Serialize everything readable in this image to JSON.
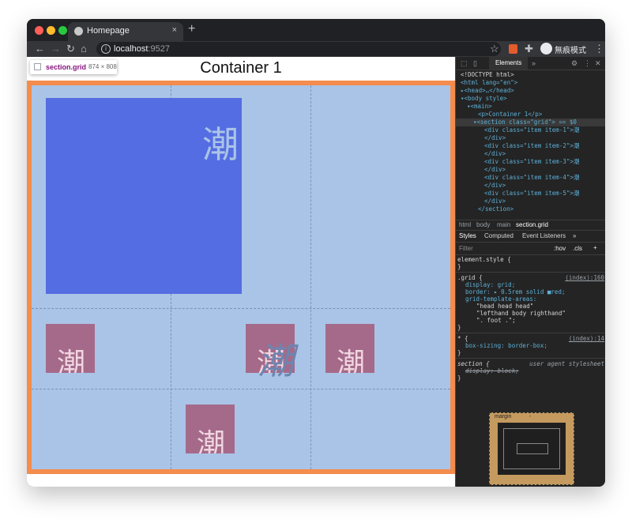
{
  "browser": {
    "tab_title": "Homepage",
    "tab_close": "×",
    "new_tab": "+",
    "url_host": "localhost",
    "url_port": ":9527",
    "profile_label": "無痕模式"
  },
  "page": {
    "title": "Container 1",
    "inspect_tooltip": {
      "name": "section.grid",
      "size": "874 × 808"
    },
    "grid_items": [
      {
        "text": "潮"
      },
      {
        "text": "潮"
      },
      {
        "text": "潮"
      },
      {
        "text": "潮"
      },
      {
        "text": "潮"
      }
    ],
    "overflow_text": "潮"
  },
  "devtools": {
    "active_tab": "Elements",
    "dom": [
      "<!DOCTYPE html>",
      "<html lang=\"en\">",
      "▸<head>…</head>",
      "▾<body style>",
      "▾<main>",
      "<p>Container 1</p>",
      "▾<section class=\"grid\"> == $0",
      "<div class=\"item item-1\">潮",
      "</div>",
      "<div class=\"item item-2\">潮",
      "</div>",
      "<div class=\"item item-3\">潮",
      "</div>",
      "<div class=\"item item-4\">潮",
      "</div>",
      "<div class=\"item item-5\">潮",
      "</div>",
      "</section>"
    ],
    "breadcrumbs": [
      "html",
      "body",
      "main",
      "section.grid"
    ],
    "subtabs": [
      "Styles",
      "Computed",
      "Event Listeners",
      "»"
    ],
    "filter_placeholder": "Filter",
    "filter_hov": ":hov",
    "filter_cls": ".cls",
    "filter_plus": "+",
    "styles": {
      "element_style": "element.style {",
      "close": "}",
      "grid_selector": ".grid {",
      "grid_source": "(index):160",
      "grid_rules": [
        "display: grid;",
        "border: ▸ 0.5rem solid ■red;",
        "grid-template-areas:",
        "\"head head head\"",
        "\"lefthand body righthand\"",
        "\". foot .\";"
      ],
      "star_selector": "* {",
      "star_source": "(index):14",
      "star_rule": "box-sizing: border-box;",
      "section_selector": "section {",
      "section_source": "user agent stylesheet",
      "section_rule": "display: block;"
    },
    "box_model_label": "margin",
    "box_model_dash": "-"
  }
}
